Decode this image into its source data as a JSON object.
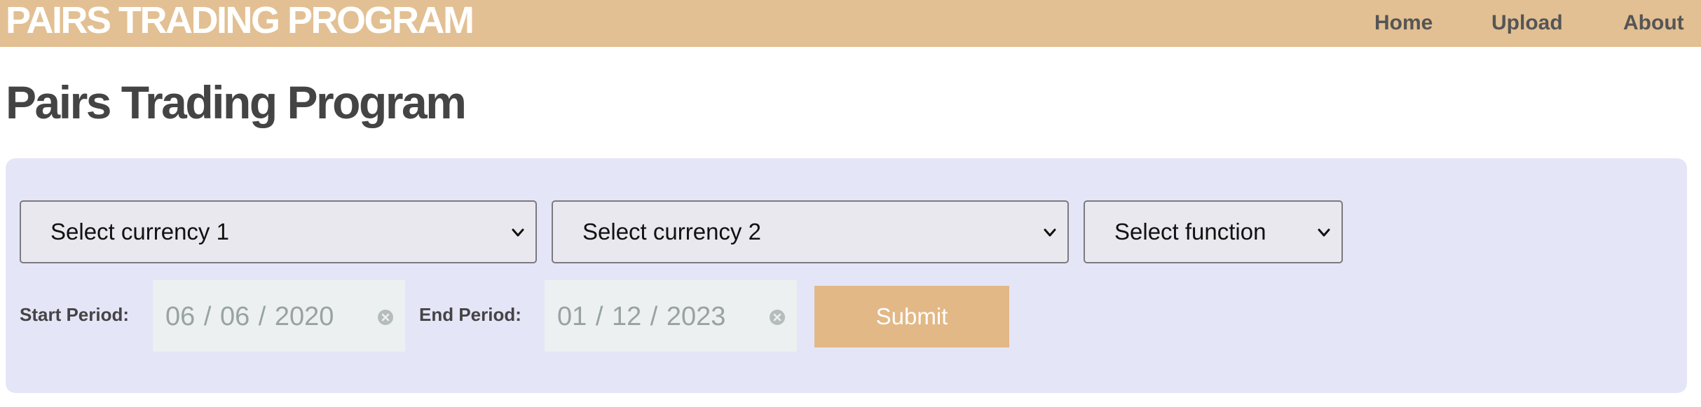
{
  "navbar": {
    "brand": "PAIRS TRADING PROGRAM",
    "links": [
      "Home",
      "Upload",
      "About"
    ]
  },
  "page": {
    "title": "Pairs Trading Program"
  },
  "form": {
    "currency1": {
      "selected": "Select currency 1"
    },
    "currency2": {
      "selected": "Select currency 2"
    },
    "function": {
      "selected": "Select function"
    },
    "start_label": "Start Period:",
    "start_value": "06 / 06 / 2020",
    "end_label": "End Period:",
    "end_value": "01 / 12 / 2023",
    "submit_label": "Submit"
  },
  "icons": {
    "dropdown": "chevron-down-icon",
    "clear": "clear-icon"
  },
  "colors": {
    "navbar_bg": "#e2c093",
    "panel_bg": "#e5e5f8",
    "submit_bg": "#e2b886",
    "title_text": "#444444",
    "nav_text": "#555555"
  }
}
